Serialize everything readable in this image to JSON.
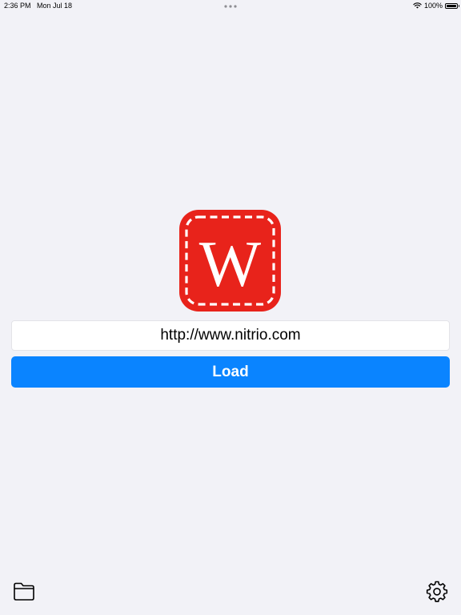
{
  "status_bar": {
    "time": "2:36 PM",
    "date": "Mon Jul 18",
    "battery": "100%",
    "battery_level": 1.0,
    "wifi_icon": "wifi-icon",
    "battery_icon": "battery-icon"
  },
  "logo": {
    "letter": "W",
    "color": "#e8231b"
  },
  "url_field": {
    "value": "http://www.nitrio.com"
  },
  "load_button": {
    "label": "Load",
    "color": "#0a84ff"
  },
  "toolbar": {
    "left_icon": "folder-icon",
    "right_icon": "gear-icon"
  }
}
